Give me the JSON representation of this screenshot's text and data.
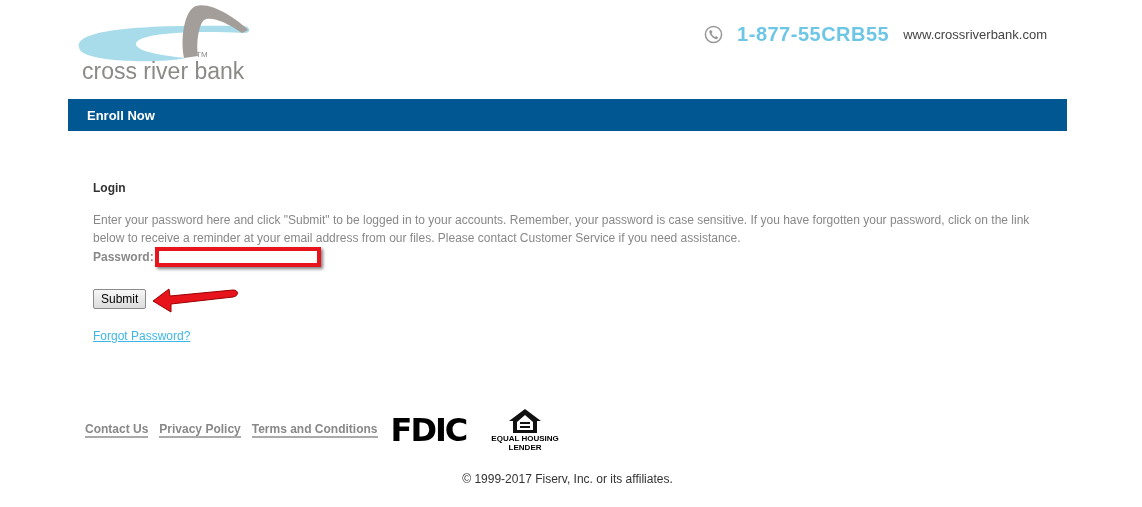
{
  "logo": {
    "name": "cross river bank",
    "tm": "TM"
  },
  "contact": {
    "phone": "1-877-55CRB55",
    "website": "www.crossriverbank.com"
  },
  "nav_bar": {
    "title": "Enroll Now"
  },
  "login": {
    "heading": "Login",
    "instructions": "Enter your password here and click \"Submit\" to be logged in to your accounts. Remember, your password is case sensitive. If you have forgotten your password, click on the link below to receive a reminder at your email address from our files. Please contact Customer Service if you need assistance.",
    "password_label": "Password:",
    "submit": "Submit",
    "forgot_link": "Forgot Password?"
  },
  "footer": {
    "links": [
      "Contact Us",
      "Privacy Policy",
      "Terms and Conditions"
    ],
    "fdic": "FDIC",
    "housing_top": "EQUAL HOUSING",
    "housing_bottom": "LENDER",
    "copyright": "© 1999-2017 Fiserv, Inc. or its affiliates."
  }
}
